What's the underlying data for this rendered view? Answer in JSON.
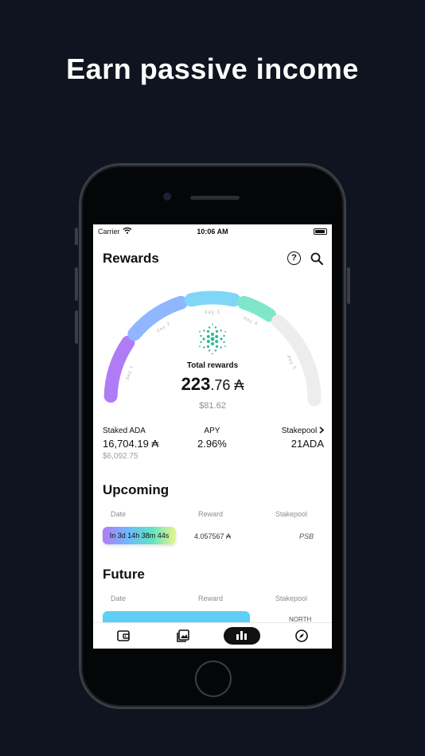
{
  "headline": "Earn passive income",
  "status_bar": {
    "carrier": "Carrier",
    "time": "10:06 AM"
  },
  "nav": {
    "title": "Rewards",
    "help_icon": "question-circle-icon",
    "search_icon": "search-icon"
  },
  "gauge": {
    "labels": [
      "day 1",
      "day 2",
      "day 3",
      "day 4",
      "day 5"
    ],
    "colors": [
      "#b07cf5",
      "#8fb6ff",
      "#7fd6f7",
      "#7fe6c8",
      "#ededee"
    ],
    "logo": "cardano-logo"
  },
  "total_rewards": {
    "label": "Total rewards",
    "whole": "223",
    "fraction": ".76 ₳",
    "fiat": "$81.62"
  },
  "stats": {
    "staked": {
      "label": "Staked ADA",
      "value": "16,704.19 ₳",
      "fiat": "$6,092.75"
    },
    "apy": {
      "label": "APY",
      "value": "2.96%"
    },
    "stakepool": {
      "label": "Stakepool",
      "value": "21ADA",
      "chevron": "chevron-right-icon"
    }
  },
  "upcoming": {
    "title": "Upcoming",
    "columns": [
      "Date",
      "Reward",
      "Stakepool"
    ],
    "rows": [
      {
        "date": "In 3d 14h 38m 44s",
        "reward": "4.057567 ₳",
        "stakepool": "PSB"
      }
    ]
  },
  "future": {
    "title": "Future",
    "columns": [
      "Date",
      "Reward",
      "Stakepool"
    ],
    "rows": [
      {
        "stakepool": "NORTH"
      }
    ]
  },
  "tabbar": {
    "tabs": [
      {
        "icon": "wallet-icon",
        "active": false
      },
      {
        "icon": "gallery-icon",
        "active": false
      },
      {
        "icon": "bar-chart-icon",
        "active": true
      },
      {
        "icon": "compass-icon",
        "active": false
      }
    ]
  }
}
